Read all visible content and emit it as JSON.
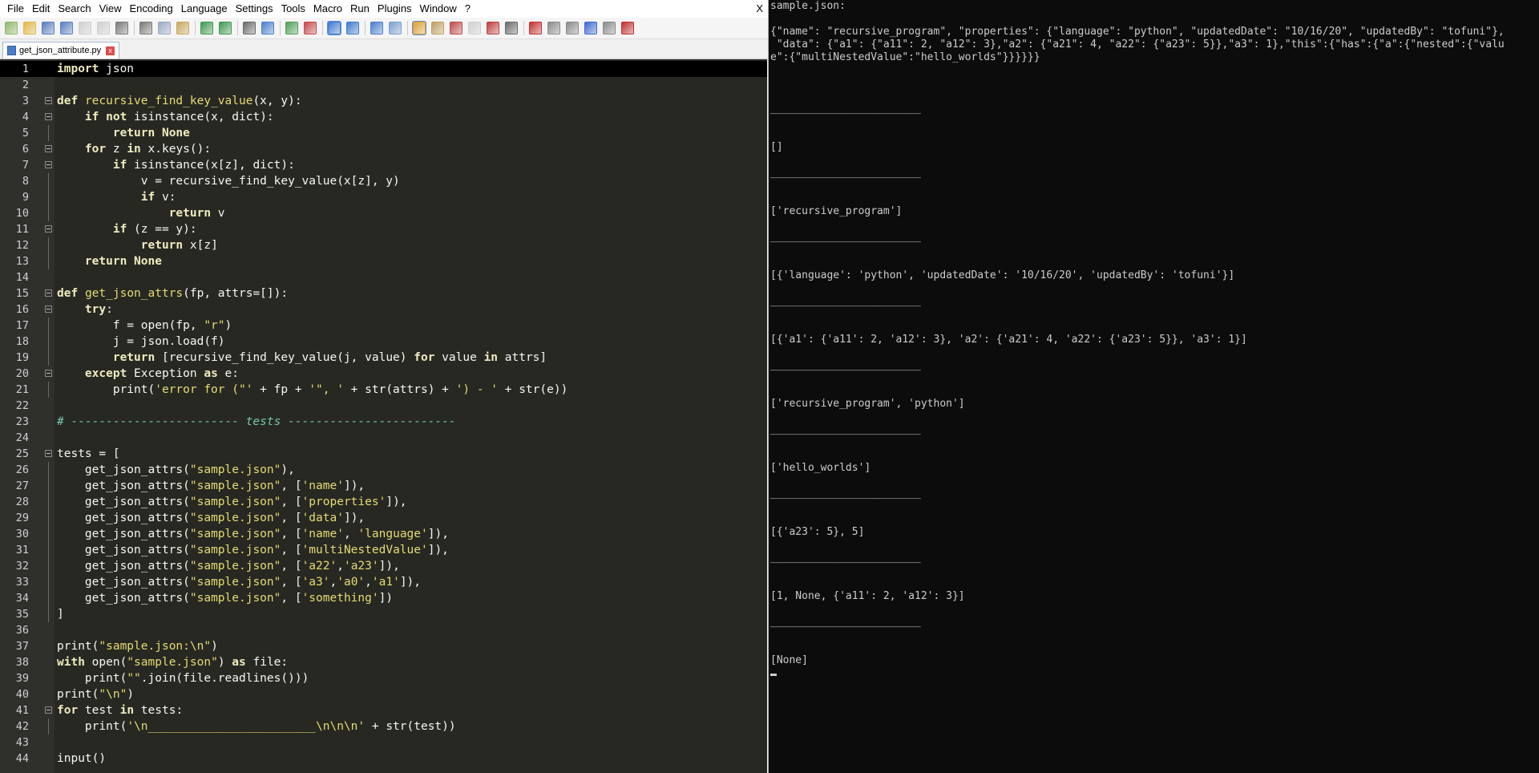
{
  "editor": {
    "menu": [
      "File",
      "Edit",
      "Search",
      "View",
      "Encoding",
      "Language",
      "Settings",
      "Tools",
      "Macro",
      "Run",
      "Plugins",
      "Window",
      "?"
    ],
    "close_symbol": "X",
    "tab": {
      "label": "get_json_attribute.py",
      "close_symbol": "x"
    },
    "toolbar_icons": [
      "new-file-icon",
      "open-file-icon",
      "save-icon",
      "save-all-icon",
      "close-icon",
      "close-all-icon",
      "print-icon",
      "cut-icon",
      "copy-icon",
      "paste-icon",
      "undo-icon",
      "redo-icon",
      "find-icon",
      "replace-icon",
      "zoom-in-icon",
      "zoom-out-icon",
      "sync-vertical-icon",
      "sync-horizontal-icon",
      "word-wrap-icon",
      "show-all-chars-icon",
      "indent-guide-icon",
      "user-lang-icon",
      "doc-map-icon",
      "function-list-icon",
      "folder-workspace-icon",
      "monitoring-icon",
      "record-macro-icon",
      "stop-record-icon",
      "playback-macro-icon",
      "run-macro-multiple-icon",
      "save-macro-icon",
      "spell-check-icon"
    ],
    "active_toolbar_icons": [
      "sync-vertical-icon",
      "indent-guide-icon"
    ],
    "current_line": 1,
    "lines": [
      "import json",
      "",
      "def recursive_find_key_value(x, y):",
      "    if not isinstance(x, dict):",
      "        return None",
      "    for z in x.keys():",
      "        if isinstance(x[z], dict):",
      "            v = recursive_find_key_value(x[z], y)",
      "            if v:",
      "                return v",
      "        if (z == y):",
      "            return x[z]",
      "    return None",
      "",
      "def get_json_attrs(fp, attrs=[]):",
      "    try:",
      "        f = open(fp, \"r\")",
      "        j = json.load(f)",
      "        return [recursive_find_key_value(j, value) for value in attrs]",
      "    except Exception as e:",
      "        print('error for (\"' + fp + '\", ' + str(attrs) + ') - ' + str(e))",
      "",
      "# ------------------------ tests ------------------------",
      "",
      "tests = [",
      "    get_json_attrs(\"sample.json\"),",
      "    get_json_attrs(\"sample.json\", ['name']),",
      "    get_json_attrs(\"sample.json\", ['properties']),",
      "    get_json_attrs(\"sample.json\", ['data']),",
      "    get_json_attrs(\"sample.json\", ['name', 'language']),",
      "    get_json_attrs(\"sample.json\", ['multiNestedValue']),",
      "    get_json_attrs(\"sample.json\", ['a22','a23']),",
      "    get_json_attrs(\"sample.json\", ['a3','a0','a1']),",
      "    get_json_attrs(\"sample.json\", ['something'])",
      "]",
      "",
      "print(\"sample.json:\\n\")",
      "with open(\"sample.json\") as file:",
      "    print(\"\".join(file.readlines()))",
      "print(\"\\n\")",
      "for test in tests:",
      "    print('\\n________________________\\n\\n\\n' + str(test))",
      "",
      "input()"
    ],
    "fold_markers": [
      3,
      4,
      6,
      7,
      11,
      15,
      16,
      20,
      25,
      41
    ]
  },
  "console": {
    "lines": [
      "sample.json:",
      "",
      "{\"name\": \"recursive_program\", \"properties\": {\"language\": \"python\", \"updatedDate\": \"10/16/20\", \"updatedBy\": \"tofuni\"},",
      " \"data\": {\"a1\": {\"a11\": 2, \"a12\": 3},\"a2\": {\"a21\": 4, \"a22\": {\"a23\": 5}},\"a3\": 1},\"this\":{\"has\":{\"a\":{\"nested\":{\"valu",
      "e\":{\"multiNestedValue\":\"hello_worlds\"}}}}}}",
      "",
      "",
      "",
      "________________________",
      "",
      "",
      "[]",
      "",
      "________________________",
      "",
      "",
      "['recursive_program']",
      "",
      "________________________",
      "",
      "",
      "[{'language': 'python', 'updatedDate': '10/16/20', 'updatedBy': 'tofuni'}]",
      "",
      "________________________",
      "",
      "",
      "[{'a1': {'a11': 2, 'a12': 3}, 'a2': {'a21': 4, 'a22': {'a23': 5}}, 'a3': 1}]",
      "",
      "________________________",
      "",
      "",
      "['recursive_program', 'python']",
      "",
      "________________________",
      "",
      "",
      "['hello_worlds']",
      "",
      "________________________",
      "",
      "",
      "[{'a23': 5}, 5]",
      "",
      "________________________",
      "",
      "",
      "[1, None, {'a11': 2, 'a12': 3}]",
      "",
      "________________________",
      "",
      "",
      "[None]"
    ]
  },
  "colors": {
    "editor_bg": "#272822",
    "gutter_bg": "#2f302b",
    "console_bg": "#0c0c0c",
    "console_text": "#cccccc",
    "keyword": "#f0ecc0",
    "string": "#e6db74",
    "comment": "#75c6ae"
  }
}
